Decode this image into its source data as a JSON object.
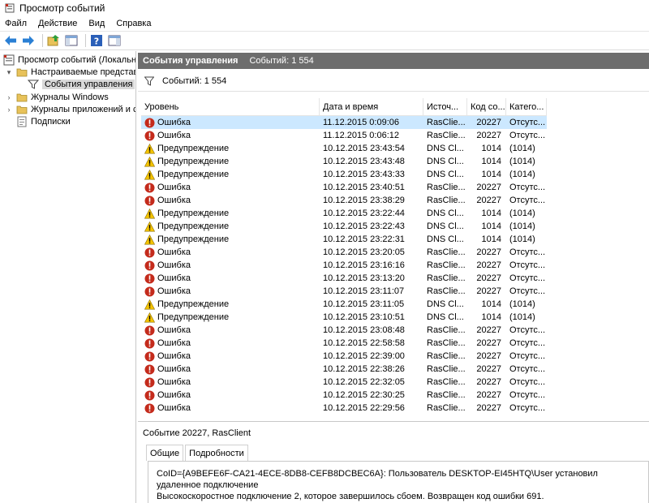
{
  "window": {
    "title": "Просмотр событий"
  },
  "menu": [
    "Файл",
    "Действие",
    "Вид",
    "Справка"
  ],
  "tree": [
    {
      "label": "Просмотр событий (Локальнь",
      "level": 0,
      "expander": "",
      "icon": "event-viewer-icon"
    },
    {
      "label": "Настраиваемые представле",
      "level": 1,
      "expander": "▾",
      "icon": "folder-icon"
    },
    {
      "label": "События управления",
      "level": 2,
      "expander": "",
      "icon": "filter-icon",
      "selected": true
    },
    {
      "label": "Журналы Windows",
      "level": 1,
      "expander": "›",
      "icon": "folder-icon"
    },
    {
      "label": "Журналы приложений и сл",
      "level": 1,
      "expander": "›",
      "icon": "folder-icon"
    },
    {
      "label": "Подписки",
      "level": 1,
      "expander": "",
      "icon": "subscriptions-icon"
    }
  ],
  "panel": {
    "title": "События управления",
    "count": "Событий: 1 554"
  },
  "filter": {
    "text": "Событий: 1 554"
  },
  "columns": [
    "Уровень",
    "Дата и время",
    "Источ...",
    "Код со...",
    "Катего..."
  ],
  "rows": [
    {
      "level": "Ошибка",
      "type": "error",
      "date": "11.12.2015 0:09:06",
      "source": "RasClie...",
      "code": "20227",
      "category": "Отсутс...",
      "selected": true
    },
    {
      "level": "Ошибка",
      "type": "error",
      "date": "11.12.2015 0:06:12",
      "source": "RasClie...",
      "code": "20227",
      "category": "Отсутс..."
    },
    {
      "level": "Предупреждение",
      "type": "warning",
      "date": "10.12.2015 23:43:54",
      "source": "DNS Cl...",
      "code": "1014",
      "category": "(1014)"
    },
    {
      "level": "Предупреждение",
      "type": "warning",
      "date": "10.12.2015 23:43:48",
      "source": "DNS Cl...",
      "code": "1014",
      "category": "(1014)"
    },
    {
      "level": "Предупреждение",
      "type": "warning",
      "date": "10.12.2015 23:43:33",
      "source": "DNS Cl...",
      "code": "1014",
      "category": "(1014)"
    },
    {
      "level": "Ошибка",
      "type": "error",
      "date": "10.12.2015 23:40:51",
      "source": "RasClie...",
      "code": "20227",
      "category": "Отсутс..."
    },
    {
      "level": "Ошибка",
      "type": "error",
      "date": "10.12.2015 23:38:29",
      "source": "RasClie...",
      "code": "20227",
      "category": "Отсутс..."
    },
    {
      "level": "Предупреждение",
      "type": "warning",
      "date": "10.12.2015 23:22:44",
      "source": "DNS Cl...",
      "code": "1014",
      "category": "(1014)"
    },
    {
      "level": "Предупреждение",
      "type": "warning",
      "date": "10.12.2015 23:22:43",
      "source": "DNS Cl...",
      "code": "1014",
      "category": "(1014)"
    },
    {
      "level": "Предупреждение",
      "type": "warning",
      "date": "10.12.2015 23:22:31",
      "source": "DNS Cl...",
      "code": "1014",
      "category": "(1014)"
    },
    {
      "level": "Ошибка",
      "type": "error",
      "date": "10.12.2015 23:20:05",
      "source": "RasClie...",
      "code": "20227",
      "category": "Отсутс..."
    },
    {
      "level": "Ошибка",
      "type": "error",
      "date": "10.12.2015 23:16:16",
      "source": "RasClie...",
      "code": "20227",
      "category": "Отсутс..."
    },
    {
      "level": "Ошибка",
      "type": "error",
      "date": "10.12.2015 23:13:20",
      "source": "RasClie...",
      "code": "20227",
      "category": "Отсутс..."
    },
    {
      "level": "Ошибка",
      "type": "error",
      "date": "10.12.2015 23:11:07",
      "source": "RasClie...",
      "code": "20227",
      "category": "Отсутс..."
    },
    {
      "level": "Предупреждение",
      "type": "warning",
      "date": "10.12.2015 23:11:05",
      "source": "DNS Cl...",
      "code": "1014",
      "category": "(1014)"
    },
    {
      "level": "Предупреждение",
      "type": "warning",
      "date": "10.12.2015 23:10:51",
      "source": "DNS Cl...",
      "code": "1014",
      "category": "(1014)"
    },
    {
      "level": "Ошибка",
      "type": "error",
      "date": "10.12.2015 23:08:48",
      "source": "RasClie...",
      "code": "20227",
      "category": "Отсутс..."
    },
    {
      "level": "Ошибка",
      "type": "error",
      "date": "10.12.2015 22:58:58",
      "source": "RasClie...",
      "code": "20227",
      "category": "Отсутс..."
    },
    {
      "level": "Ошибка",
      "type": "error",
      "date": "10.12.2015 22:39:00",
      "source": "RasClie...",
      "code": "20227",
      "category": "Отсутс..."
    },
    {
      "level": "Ошибка",
      "type": "error",
      "date": "10.12.2015 22:38:26",
      "source": "RasClie...",
      "code": "20227",
      "category": "Отсутс..."
    },
    {
      "level": "Ошибка",
      "type": "error",
      "date": "10.12.2015 22:32:05",
      "source": "RasClie...",
      "code": "20227",
      "category": "Отсутс..."
    },
    {
      "level": "Ошибка",
      "type": "error",
      "date": "10.12.2015 22:30:25",
      "source": "RasClie...",
      "code": "20227",
      "category": "Отсутс..."
    },
    {
      "level": "Ошибка",
      "type": "error",
      "date": "10.12.2015 22:29:56",
      "source": "RasClie...",
      "code": "20227",
      "category": "Отсутс..."
    }
  ],
  "detail": {
    "header": "Событие 20227, RasClient",
    "tabs": [
      "Общие",
      "Подробности"
    ],
    "line1": "CoID={A9BEFE6F-CA21-4ECE-8DB8-CEFB8DCBEC6A}: Пользователь DESKTOP-EI45HTQ\\User установил удаленное подключение",
    "line2": "Высокоскоростное подключение 2, которое завершилось сбоем. Возвращен код ошибки 691."
  },
  "colors": {
    "error": "#c42b1c",
    "warning": "#f5c400",
    "selected_row": "#cce8ff",
    "header_bg": "#6d6d6d"
  }
}
